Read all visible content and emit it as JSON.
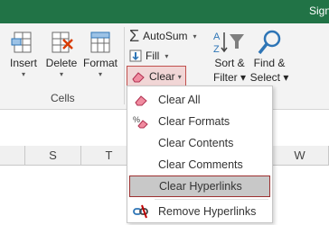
{
  "title": "Sign",
  "ribbon": {
    "cells_group": {
      "label": "Cells",
      "insert": "Insert",
      "delete": "Delete",
      "format": "Format"
    },
    "editing": {
      "autosum": "AutoSum",
      "fill": "Fill",
      "clear": "Clear",
      "sort_line1": "Sort &",
      "sort_line2": "Filter",
      "find_line1": "Find &",
      "find_line2": "Select"
    }
  },
  "columns": [
    "S",
    "T",
    "W"
  ],
  "clear_menu": {
    "items": [
      {
        "label": "Clear All",
        "icon": "eraser-icon"
      },
      {
        "label": "Clear Formats",
        "icon": "percent-eraser-icon"
      },
      {
        "label": "Clear Contents",
        "icon": ""
      },
      {
        "label": "Clear Comments",
        "icon": ""
      },
      {
        "label": "Clear Hyperlinks",
        "icon": ""
      },
      {
        "label": "Remove Hyperlinks",
        "icon": "broken-link-icon"
      }
    ]
  },
  "colors": {
    "title_bar": "#217346",
    "highlight_border": "#9c3030"
  }
}
